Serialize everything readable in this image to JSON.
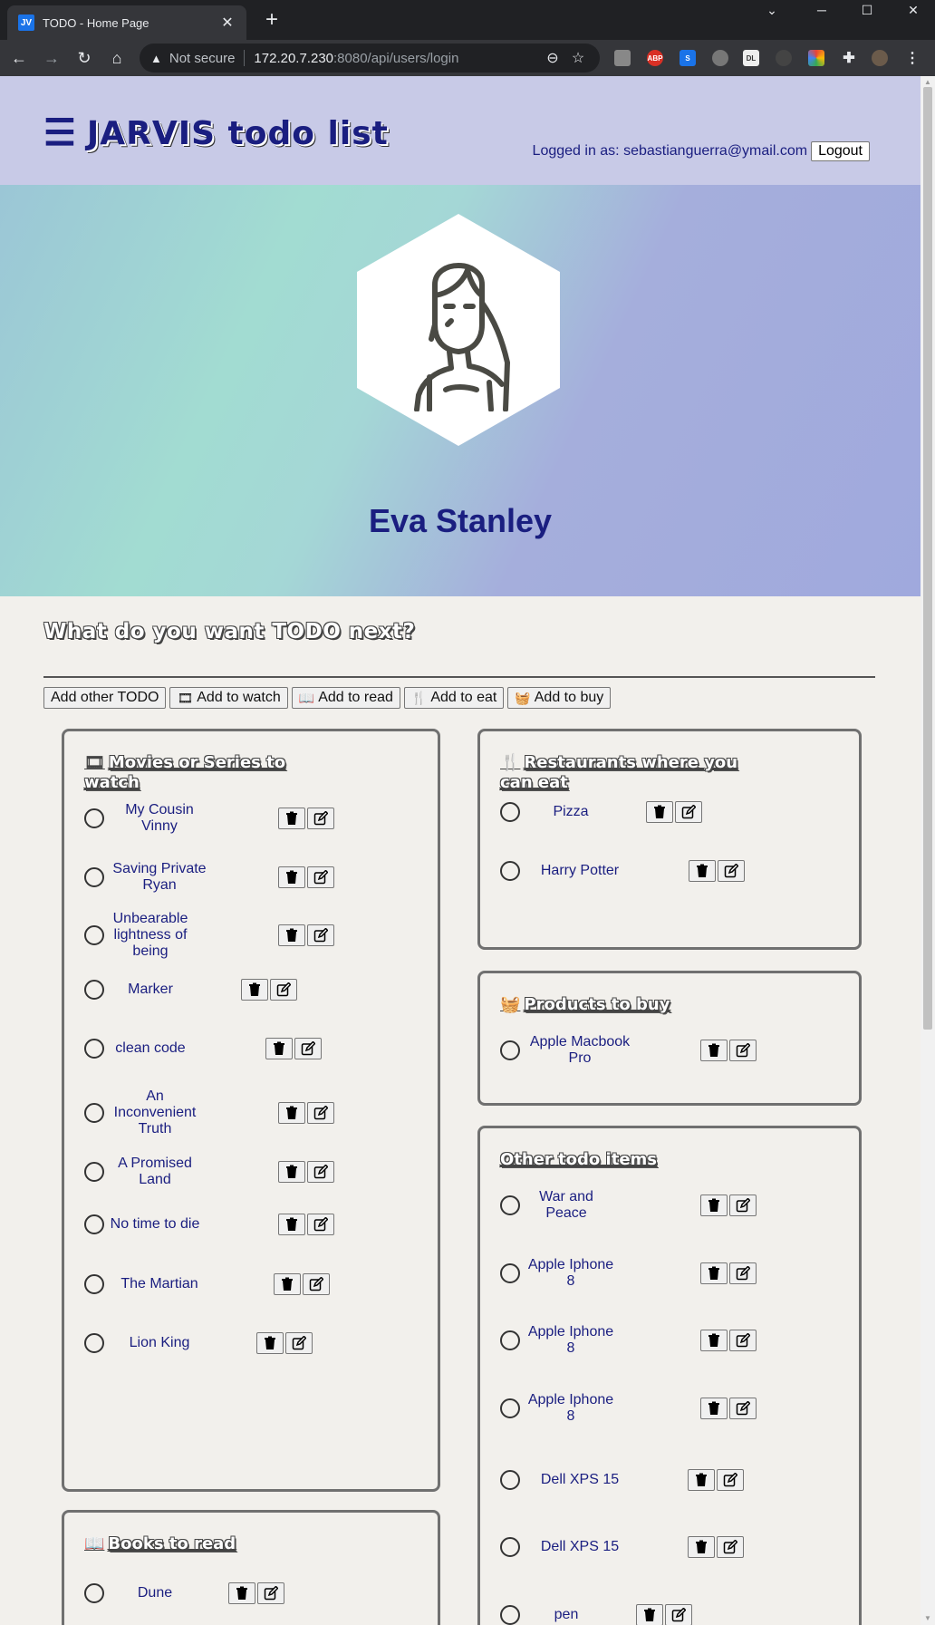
{
  "browser": {
    "tab_title": "TODO - Home Page",
    "tab_favicon": "JV",
    "not_secure": "Not secure",
    "url_host": "172.20.7.230",
    "url_rest": ":8080/api/users/login"
  },
  "header": {
    "logo_icon": "list-check-icon",
    "title": "JARVIS todo list",
    "logged_in_as": "Logged in as: sebastianguerra@ymail.com",
    "logout": "Logout"
  },
  "profile": {
    "name": "Eva Stanley"
  },
  "todo": {
    "heading": "What do you want TODO next?",
    "add_other": "Add other TODO",
    "add_watch": "Add to watch",
    "add_read": "Add to read",
    "add_eat": "Add to eat",
    "add_buy": "Add to buy"
  },
  "cards": {
    "watch": {
      "title": "Movies or Series to watch",
      "items": [
        "My Cousin Vinny",
        "Saving Private Ryan",
        "Unbearable lightness of being",
        "Marker",
        "clean code",
        "An Inconvenient Truth",
        "A Promised Land",
        "No time to die",
        "The Martian",
        "Lion King"
      ]
    },
    "books": {
      "title": "Books to read",
      "items": [
        "Dune"
      ]
    },
    "eat": {
      "title": "Restaurants where you can eat",
      "items": [
        "Pizza",
        "Harry Potter"
      ]
    },
    "buy": {
      "title": "Products to buy",
      "items": [
        "Apple Macbook Pro"
      ]
    },
    "other": {
      "title": "Other todo items",
      "items": [
        "War and Peace",
        "Apple Iphone 8",
        "Apple Iphone 8",
        "Apple Iphone 8",
        "Dell XPS 15",
        "Dell XPS 15",
        "pen"
      ]
    }
  }
}
